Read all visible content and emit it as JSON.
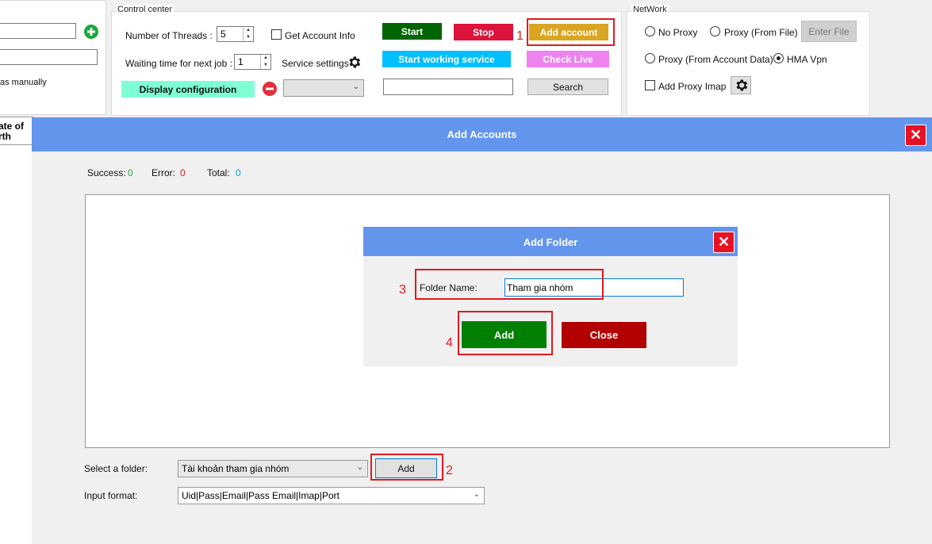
{
  "left_panel": {
    "manual_text": "as manually",
    "column_header": "ate of\nrth"
  },
  "control_center": {
    "title": "Control center",
    "threads_label": "Number of Threads :",
    "threads_value": "5",
    "wait_label": "Waiting time for next job :",
    "wait_value": "1",
    "get_account_info_label": "Get Account Info",
    "service_settings_label": "Service settings",
    "display_config_label": "Display configuration",
    "start_label": "Start",
    "stop_label": "Stop",
    "add_account_label": "Add account",
    "start_service_label": "Start working service",
    "check_live_label": "Check Live",
    "search_label": "Search",
    "search_value": ""
  },
  "network": {
    "title": "NetWork",
    "no_proxy": "No Proxy",
    "proxy_file": "Proxy (From File)",
    "enter_file": "Enter File",
    "proxy_account": "Proxy (From Account Data)",
    "hma_vpn": "HMA Vpn",
    "add_proxy_imap": "Add Proxy Imap",
    "selected": "HMA Vpn"
  },
  "add_accounts": {
    "title": "Add Accounts",
    "success_label": "Success:",
    "success_value": "0",
    "error_label": "Error:",
    "error_value": "0",
    "total_label": "Total:",
    "total_value": "0",
    "select_folder_label": "Select a folder:",
    "folder_value": "Tài khoản tham gia nhóm",
    "add_label": "Add",
    "input_format_label": "Input format:",
    "input_format_value": "Uid|Pass|Email|Pass Email|Imap|Port"
  },
  "add_folder": {
    "title": "Add Folder",
    "folder_name_label": "Folder Name:",
    "folder_name_value": "Tham gia nhóm",
    "add_label": "Add",
    "close_label": "Close"
  },
  "steps": [
    "1",
    "2",
    "3",
    "4"
  ],
  "colors": {
    "header_blue": "#6495ed",
    "start_green": "#006400",
    "stop_red": "#dc143c",
    "add_account_gold": "#daa520",
    "service_cyan": "#00bfff",
    "check_live_pink": "#ee82ee",
    "config_green": "#7fffd4",
    "dialog_add_green": "#008000",
    "dialog_close_red": "#b20000",
    "annotation_red": "#e0191e"
  }
}
